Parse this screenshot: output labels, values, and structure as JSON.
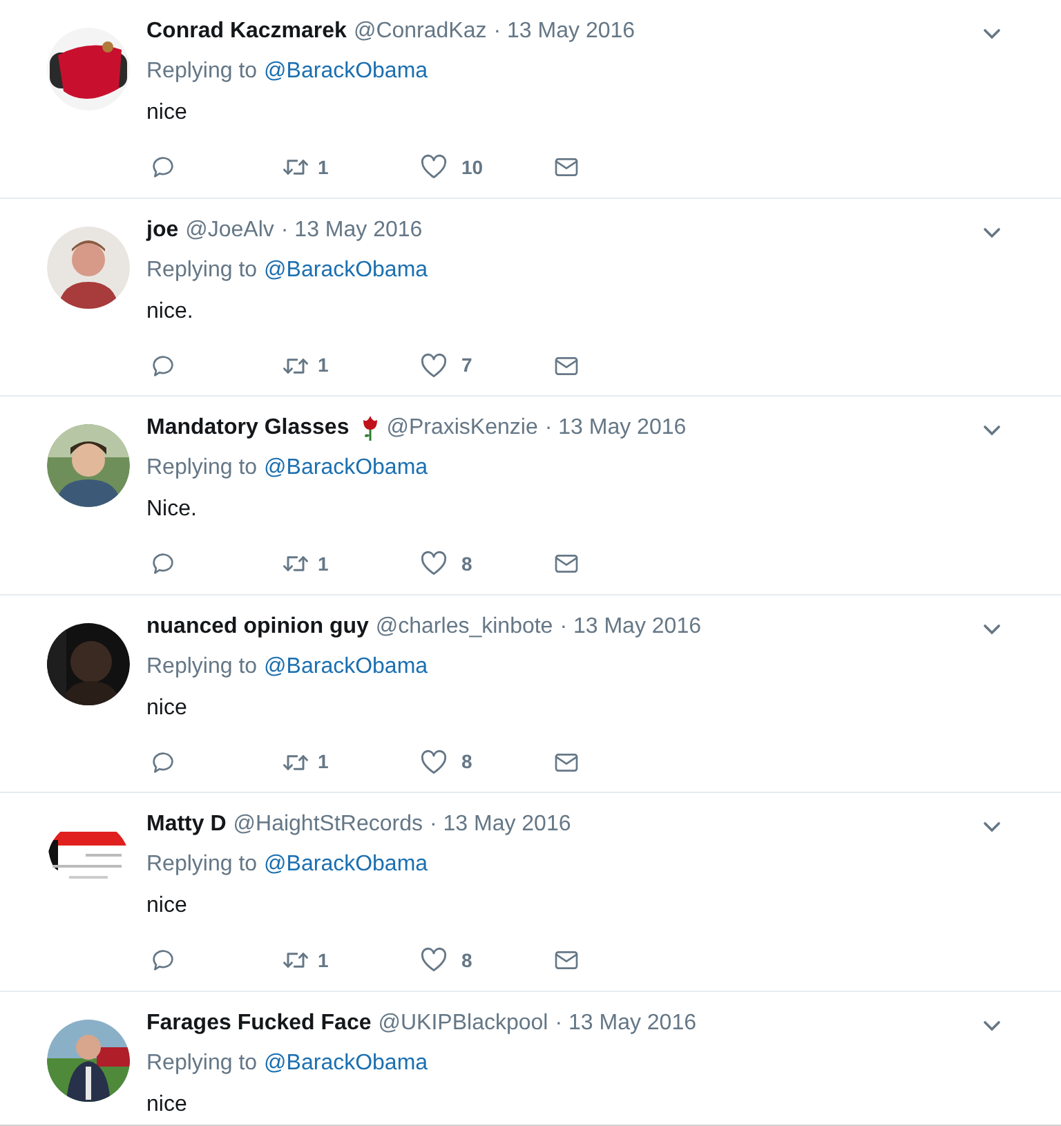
{
  "tweets": [
    {
      "name": "Conrad Kaczmarek",
      "handle": "@ConradKaz",
      "date": "· 13 May 2016",
      "reply_label": "Replying to",
      "mention": "@BarackObama",
      "text": "nice",
      "retweets": "1",
      "likes": "10"
    },
    {
      "name": "joe",
      "handle": "@JoeAlv",
      "date": "· 13 May 2016",
      "reply_label": "Replying to",
      "mention": "@BarackObama",
      "text": "nice.",
      "retweets": "1",
      "likes": "7"
    },
    {
      "name": "Mandatory Glasses",
      "flower_icon": true,
      "handle": "@PraxisKenzie",
      "date": "· 13 May 2016",
      "reply_label": "Replying to",
      "mention": "@BarackObama",
      "text": "Nice.",
      "retweets": "1",
      "likes": "8"
    },
    {
      "name": "nuanced opinion guy",
      "handle": "@charles_kinbote",
      "date": "· 13 May 2016",
      "reply_label": "Replying to",
      "mention": "@BarackObama",
      "text": "nice",
      "retweets": "1",
      "likes": "8"
    },
    {
      "name": "Matty D",
      "handle": "@HaightStRecords",
      "date": "· 13 May 2016",
      "reply_label": "Replying to",
      "mention": "@BarackObama",
      "text": "nice",
      "retweets": "1",
      "likes": "8"
    },
    {
      "name": "Farages Fucked Face",
      "handle": "@UKIPBlackpool",
      "date": "· 13 May 2016",
      "reply_label": "Replying to",
      "mention": "@BarackObama",
      "text": "nice"
    }
  ]
}
